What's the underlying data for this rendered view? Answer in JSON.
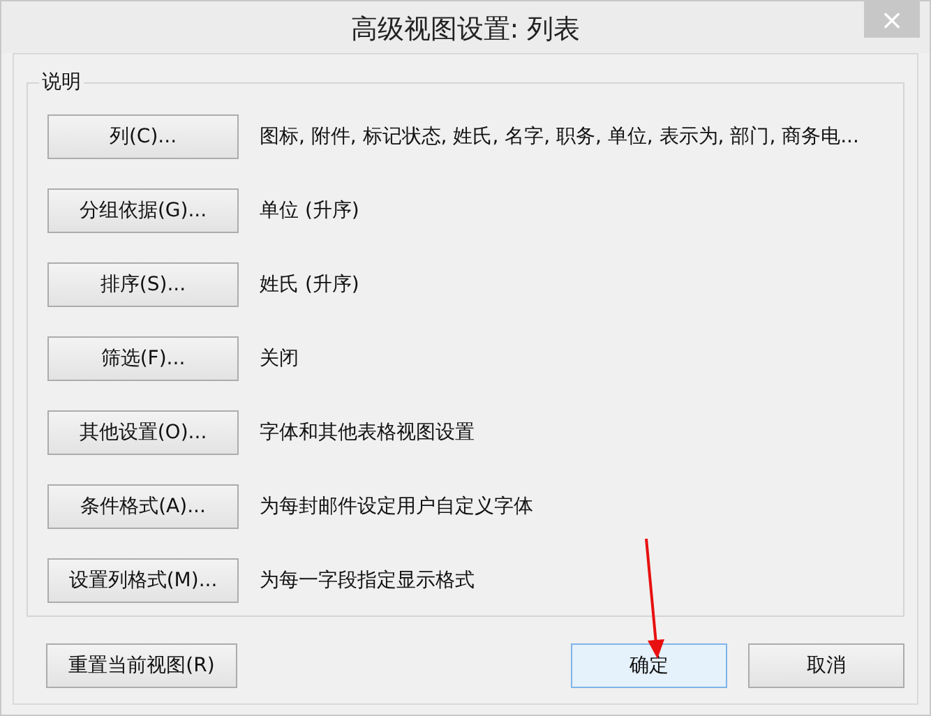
{
  "window": {
    "title": "高级视图设置: 列表",
    "close": "×"
  },
  "group": {
    "legend": "说明",
    "rows": [
      {
        "button": "列(C)...",
        "description": "图标, 附件, 标记状态, 姓氏, 名字, 职务, 单位, 表示为, 部门, 商务电..."
      },
      {
        "button": "分组依据(G)...",
        "description": "单位 (升序)"
      },
      {
        "button": "排序(S)...",
        "description": "姓氏 (升序)"
      },
      {
        "button": "筛选(F)...",
        "description": "关闭"
      },
      {
        "button": "其他设置(O)...",
        "description": "字体和其他表格视图设置"
      },
      {
        "button": "条件格式(A)...",
        "description": "为每封邮件设定用户自定义字体"
      },
      {
        "button": "设置列格式(M)...",
        "description": "为每一字段指定显示格式"
      }
    ]
  },
  "footer": {
    "reset": "重置当前视图(R)",
    "buttons": [
      {
        "label": "确定",
        "default": true
      },
      {
        "label": "取消",
        "default": false
      }
    ]
  }
}
